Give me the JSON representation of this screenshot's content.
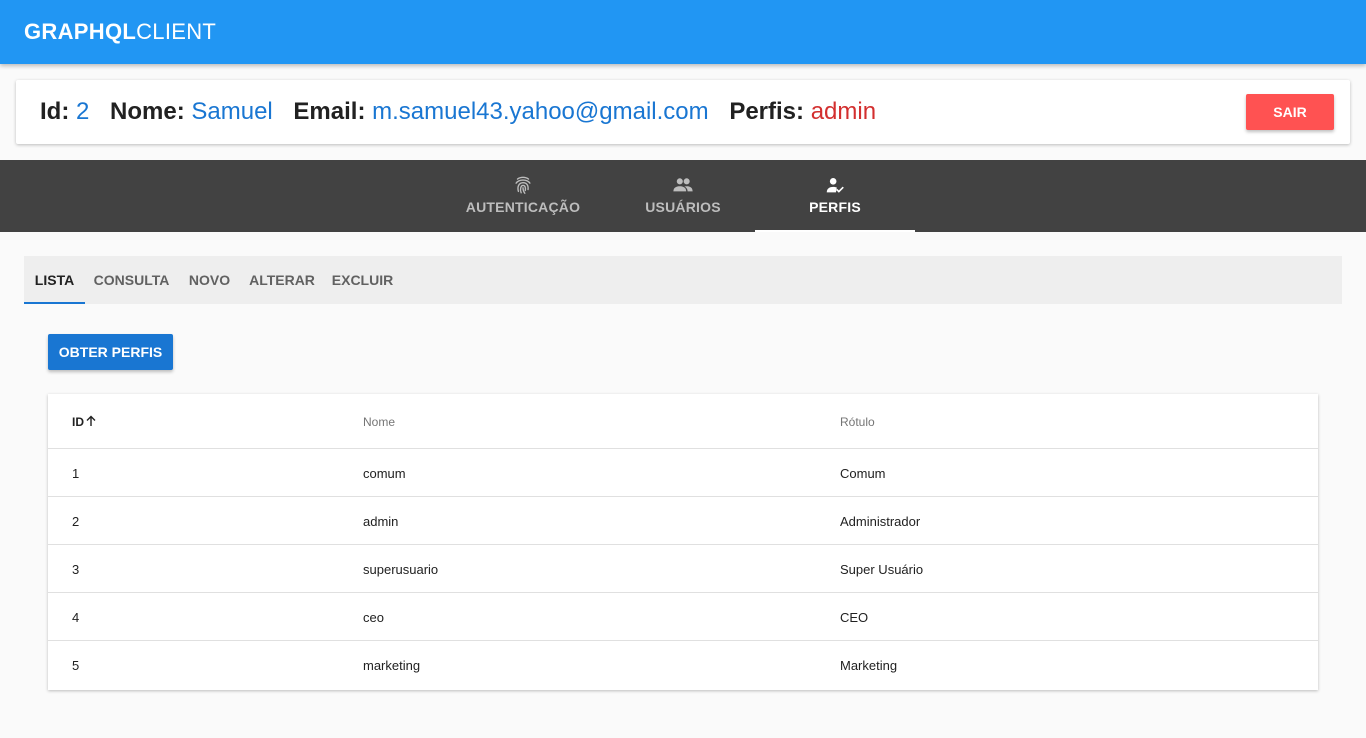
{
  "appbar": {
    "brand_bold": "GRAPHQL",
    "brand_light": "CLIENT"
  },
  "user": {
    "id_label": "Id:",
    "id_value": "2",
    "nome_label": "Nome:",
    "nome_value": "Samuel",
    "email_label": "Email:",
    "email_value": "m.samuel43.yahoo@gmail.com",
    "perfis_label": "Perfis:",
    "perfis_value": "admin",
    "logout_label": "SAIR"
  },
  "nav": {
    "tabs": [
      {
        "label": "AUTENTICAÇÃO",
        "icon": "fingerprint-icon"
      },
      {
        "label": "USUÁRIOS",
        "icon": "people-icon"
      },
      {
        "label": "PERFIS",
        "icon": "user-check-icon",
        "active": true
      }
    ]
  },
  "subtabs": [
    {
      "label": "LISTA",
      "active": true
    },
    {
      "label": "CONSULTA"
    },
    {
      "label": "NOVO"
    },
    {
      "label": "ALTERAR"
    },
    {
      "label": "EXCLUIR"
    }
  ],
  "action": {
    "label": "OBTER PERFIS"
  },
  "table": {
    "headers": [
      "ID",
      "Nome",
      "Rótulo"
    ],
    "sort": {
      "column": "ID",
      "direction": "ascending",
      "icon": "arrow-up-icon"
    },
    "rows": [
      [
        "1",
        "comum",
        "Comum"
      ],
      [
        "2",
        "admin",
        "Administrador"
      ],
      [
        "3",
        "superusuario",
        "Super Usuário"
      ],
      [
        "4",
        "ceo",
        "CEO"
      ],
      [
        "5",
        "marketing",
        "Marketing"
      ]
    ]
  },
  "colors": {
    "appbar": "#2196f3",
    "navbar": "#424242",
    "logout_button": "#ff5252",
    "primary_button": "#1976d2",
    "value_text": "#1976d2",
    "role_text": "#d32f2f"
  }
}
